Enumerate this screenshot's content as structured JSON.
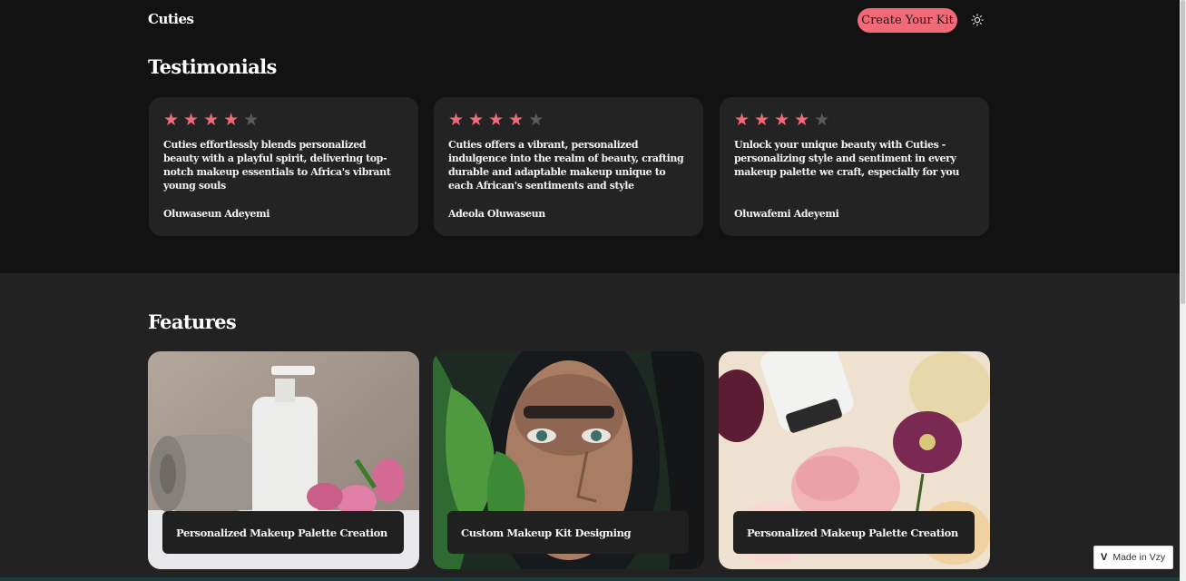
{
  "header": {
    "brand": "Cuties",
    "cta_label": "Create Your Kit",
    "theme_icon": "sun-icon"
  },
  "testimonials": {
    "title": "Testimonials",
    "items": [
      {
        "rating": 4,
        "max_rating": 5,
        "quote": "Cuties effortlessly blends personalized beauty with a playful spirit, delivering top-notch makeup essentials to Africa's vibrant young souls",
        "author": "Oluwaseun Adeyemi"
      },
      {
        "rating": 4,
        "max_rating": 5,
        "quote": "Cuties offers a vibrant, personalized indulgence into the realm of beauty, crafting durable and adaptable makeup unique to each African's sentiments and style",
        "author": "Adeola Oluwaseun"
      },
      {
        "rating": 4,
        "max_rating": 5,
        "quote": "Unlock your unique beauty with Cuties - personalizing style and sentiment in every makeup palette we craft, especially for you",
        "author": "Oluwafemi Adeyemi"
      }
    ]
  },
  "features": {
    "title": "Features",
    "items": [
      {
        "label": "Personalized Makeup Palette Creation",
        "image_icon": "bottle-towel-flowers-photo"
      },
      {
        "label": "Custom Makeup Kit Designing",
        "image_icon": "woman-leaves-portrait-photo"
      },
      {
        "label": "Personalized Makeup Palette Creation",
        "image_icon": "bottle-pink-flowers-photo"
      }
    ]
  },
  "badge": {
    "label": "Made in Vzy",
    "mark": "V"
  },
  "colors": {
    "accent": "#f26a78",
    "background": "#121212",
    "card": "#232323",
    "features_band": "#222222",
    "star_off": "#5a5a5a"
  }
}
